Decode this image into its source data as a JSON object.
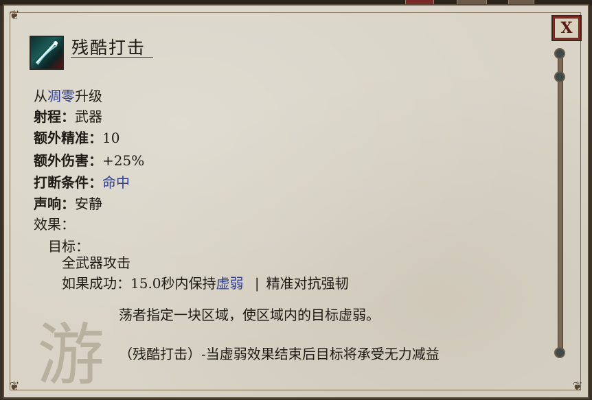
{
  "ability": {
    "title": "残酷打击",
    "icon": "sword-slash-icon",
    "upgrade_prefix": "从",
    "upgrade_link": "凋零",
    "upgrade_suffix": "升级",
    "range_label": "射程：",
    "range_value": "武器",
    "accuracy_label": "额外精准：",
    "accuracy_value": "10",
    "damage_label": "额外伤害：",
    "damage_value": "+25%",
    "interrupt_label": "打断条件：",
    "interrupt_value": "命中",
    "noise_label": "声响：",
    "noise_value": "安静",
    "effects_label": "效果：",
    "target_label": "目标：",
    "target_value": "全武器攻击",
    "on_success_label": "如果成功：",
    "on_success_text": "15.0秒内保持",
    "on_success_link": "虚弱",
    "separator": "|",
    "on_success_defense": "精准对抗强韧",
    "watermark": "游",
    "description_1": "荡者指定一块区域，使区域内的目标虚弱。",
    "description_2": "（残酷打击）-当虚弱效果结束后目标将承受无力减益"
  },
  "window": {
    "close_label": "X"
  },
  "colors": {
    "parchment": "#d9d4c7",
    "link": "#2f3d8c",
    "close_button": "#8a2a24"
  }
}
